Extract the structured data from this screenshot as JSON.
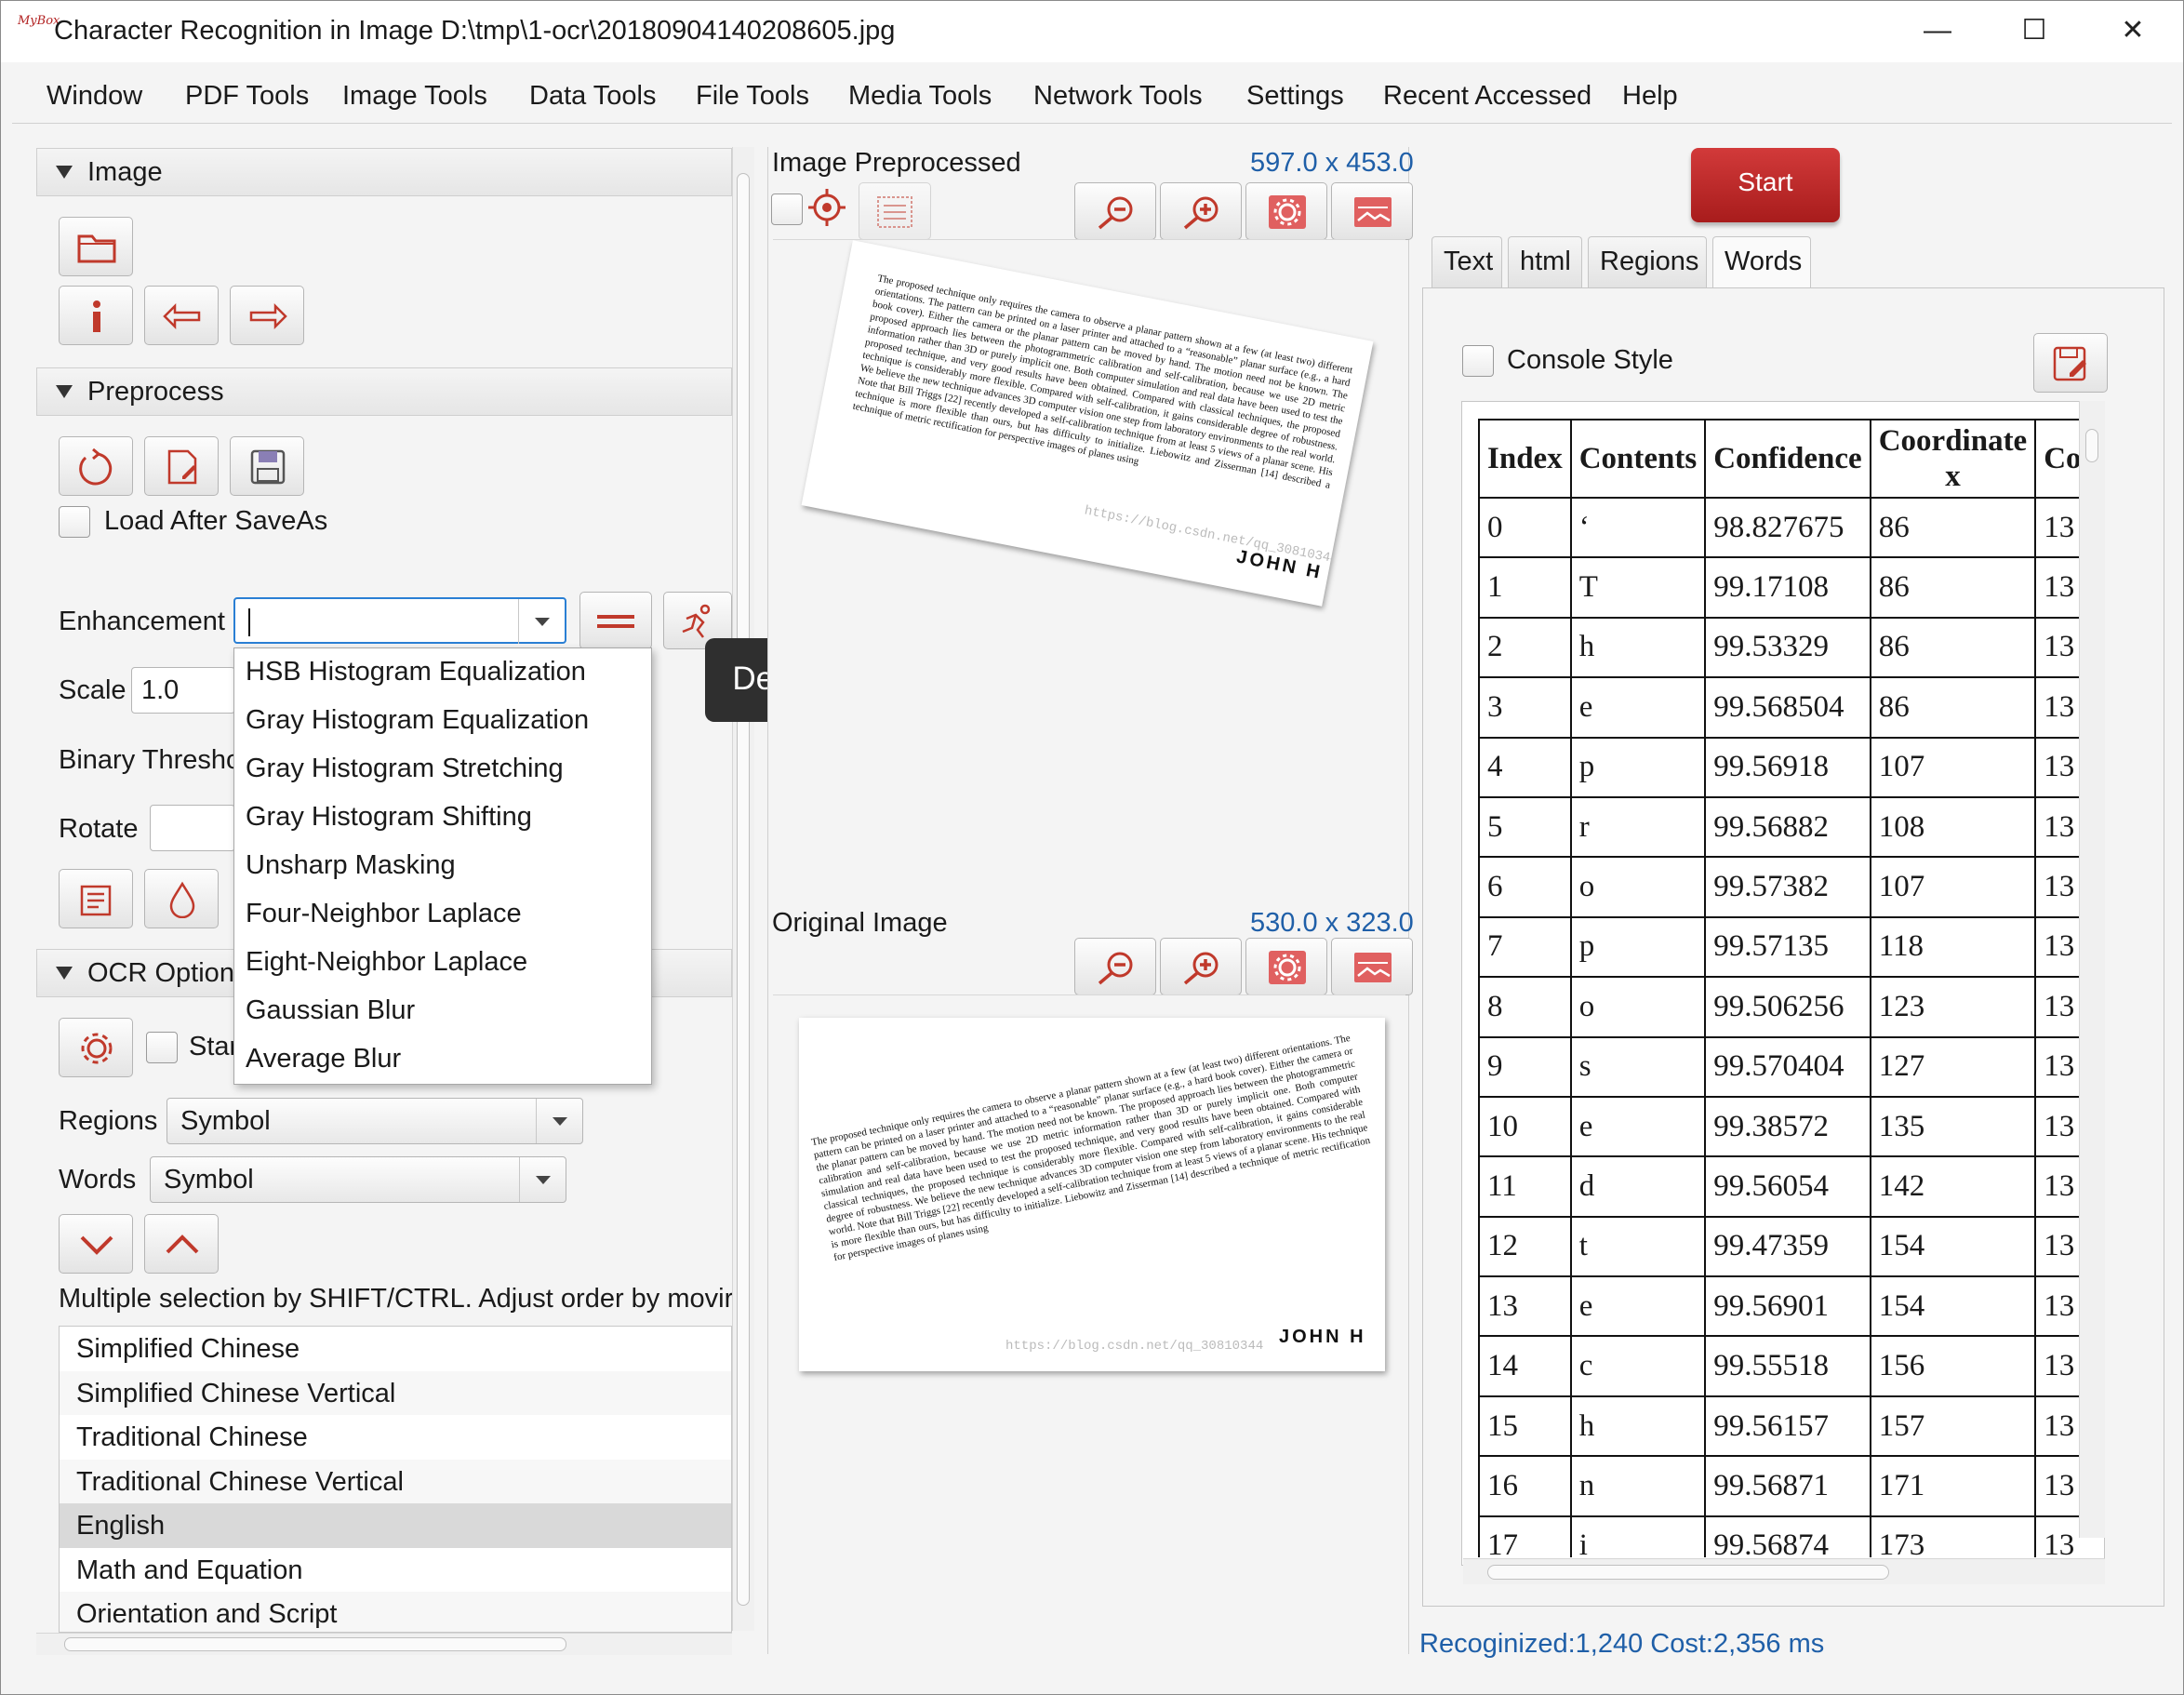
{
  "window": {
    "app_icon": "MyBox",
    "title": "Character Recognition in Image D:\\tmp\\1-ocr\\20180904140208605.jpg",
    "minimize_glyph": "—",
    "maximize_glyph": "☐",
    "close_glyph": "✕"
  },
  "menubar": [
    "Window",
    "PDF Tools",
    "Image Tools",
    "Data Tools",
    "File Tools",
    "Media Tools",
    "Network Tools",
    "Settings",
    "Recent Accessed",
    "Help"
  ],
  "left": {
    "image_section": "Image",
    "preprocess_section": "Preprocess",
    "load_after_saveas": "Load After SaveAs",
    "enhancement_label": "Enhancement",
    "enhancement_value": "",
    "scale_label": "Scale",
    "scale_value": "1.0",
    "binary_label": "Binary Thresho",
    "rotate_label": "Rotate",
    "ocr_section": "OCR Option",
    "ocr_start_checkbox": "Star",
    "regions_label": "Regions",
    "regions_value": "Symbol",
    "words_label": "Words",
    "words_value": "Symbol",
    "hint": "Multiple selection by SHIFT/CTRL. Adjust order by movir",
    "languages": [
      "Simplified Chinese",
      "Simplified Chinese Vertical",
      "Traditional Chinese",
      "Traditional Chinese Vertical",
      "English",
      "Math and Equation",
      "Orientation and Script"
    ],
    "selected_language": "English"
  },
  "enhancement_options": [
    "HSB Histogram Equalization",
    "Gray Histogram Equalization",
    "Gray Histogram Stretching",
    "Gray Histogram Shifting",
    "Unsharp Masking",
    "Four-Neighbor Laplace",
    "Eight-Neighbor Laplace",
    "Gaussian Blur",
    "Average Blur"
  ],
  "tooltip": "Demo",
  "middle": {
    "preprocessed_label": "Image Preprocessed",
    "preprocessed_size": "597.0 x 453.0",
    "original_label": "Original Image",
    "original_size": "530.0 x 323.0",
    "doc_text": "The proposed technique only requires the camera to observe a planar pattern shown at a few (at least two) different orientations. The pattern can be printed on a laser printer and attached to a “reasonable” planar surface (e.g., a hard book cover). Either the camera or the planar pattern can be moved by hand. The motion need not be known. The proposed approach lies between the photogrammetric calibration and self-calibration, because we use 2D metric information rather than 3D or purely implicit one. Both computer simulation and real data have been used to test the proposed technique, and very good results have been obtained. Compared with classical techniques, the proposed technique is considerably more flexible. Compared with self-calibration, it gains considerable degree of robustness. We believe the new technique advances 3D computer vision one step from laboratory environments to the real world. Note that Bill Triggs [22] recently developed a self-calibration technique from at least 5 views of a planar scene. His technique is more flexible than ours, but has difficulty to initialize. Liebowitz and Zisserman [14] described a technique of metric rectification for perspective images of planes using",
    "watermark": "https://blog.csdn.net/qq_30810344",
    "signature": "JOHN H"
  },
  "right": {
    "start_button": "Start",
    "tabs": [
      "Text",
      "html",
      "Regions",
      "Words"
    ],
    "selected_tab": "Words",
    "console_style": "Console Style",
    "columns": [
      "Index",
      "Contents",
      "Confidence",
      "Coordinate x",
      "Co"
    ],
    "rows": [
      [
        "0",
        "‘",
        "98.827675",
        "86",
        "13"
      ],
      [
        "1",
        "T",
        "99.17108",
        "86",
        "13"
      ],
      [
        "2",
        "h",
        "99.53329",
        "86",
        "13"
      ],
      [
        "3",
        "e",
        "99.568504",
        "86",
        "13"
      ],
      [
        "4",
        "p",
        "99.56918",
        "107",
        "13"
      ],
      [
        "5",
        "r",
        "99.56882",
        "108",
        "13"
      ],
      [
        "6",
        "o",
        "99.57382",
        "107",
        "13"
      ],
      [
        "7",
        "p",
        "99.57135",
        "118",
        "13"
      ],
      [
        "8",
        "o",
        "99.506256",
        "123",
        "13"
      ],
      [
        "9",
        "s",
        "99.570404",
        "127",
        "13"
      ],
      [
        "10",
        "e",
        "99.38572",
        "135",
        "13"
      ],
      [
        "11",
        "d",
        "99.56054",
        "142",
        "13"
      ],
      [
        "12",
        "t",
        "99.47359",
        "154",
        "13"
      ],
      [
        "13",
        "e",
        "99.56901",
        "154",
        "13"
      ],
      [
        "14",
        "c",
        "99.55518",
        "156",
        "13"
      ],
      [
        "15",
        "h",
        "99.56157",
        "157",
        "13"
      ],
      [
        "16",
        "n",
        "99.56871",
        "171",
        "13"
      ],
      [
        "17",
        "i",
        "99.56874",
        "173",
        "13"
      ]
    ],
    "status": "Recoginized:1,240  Cost:2,356 ms"
  },
  "colors": {
    "accent_red": "#c0392b",
    "link_blue": "#1f5fa8",
    "start_button": "#b82020"
  }
}
